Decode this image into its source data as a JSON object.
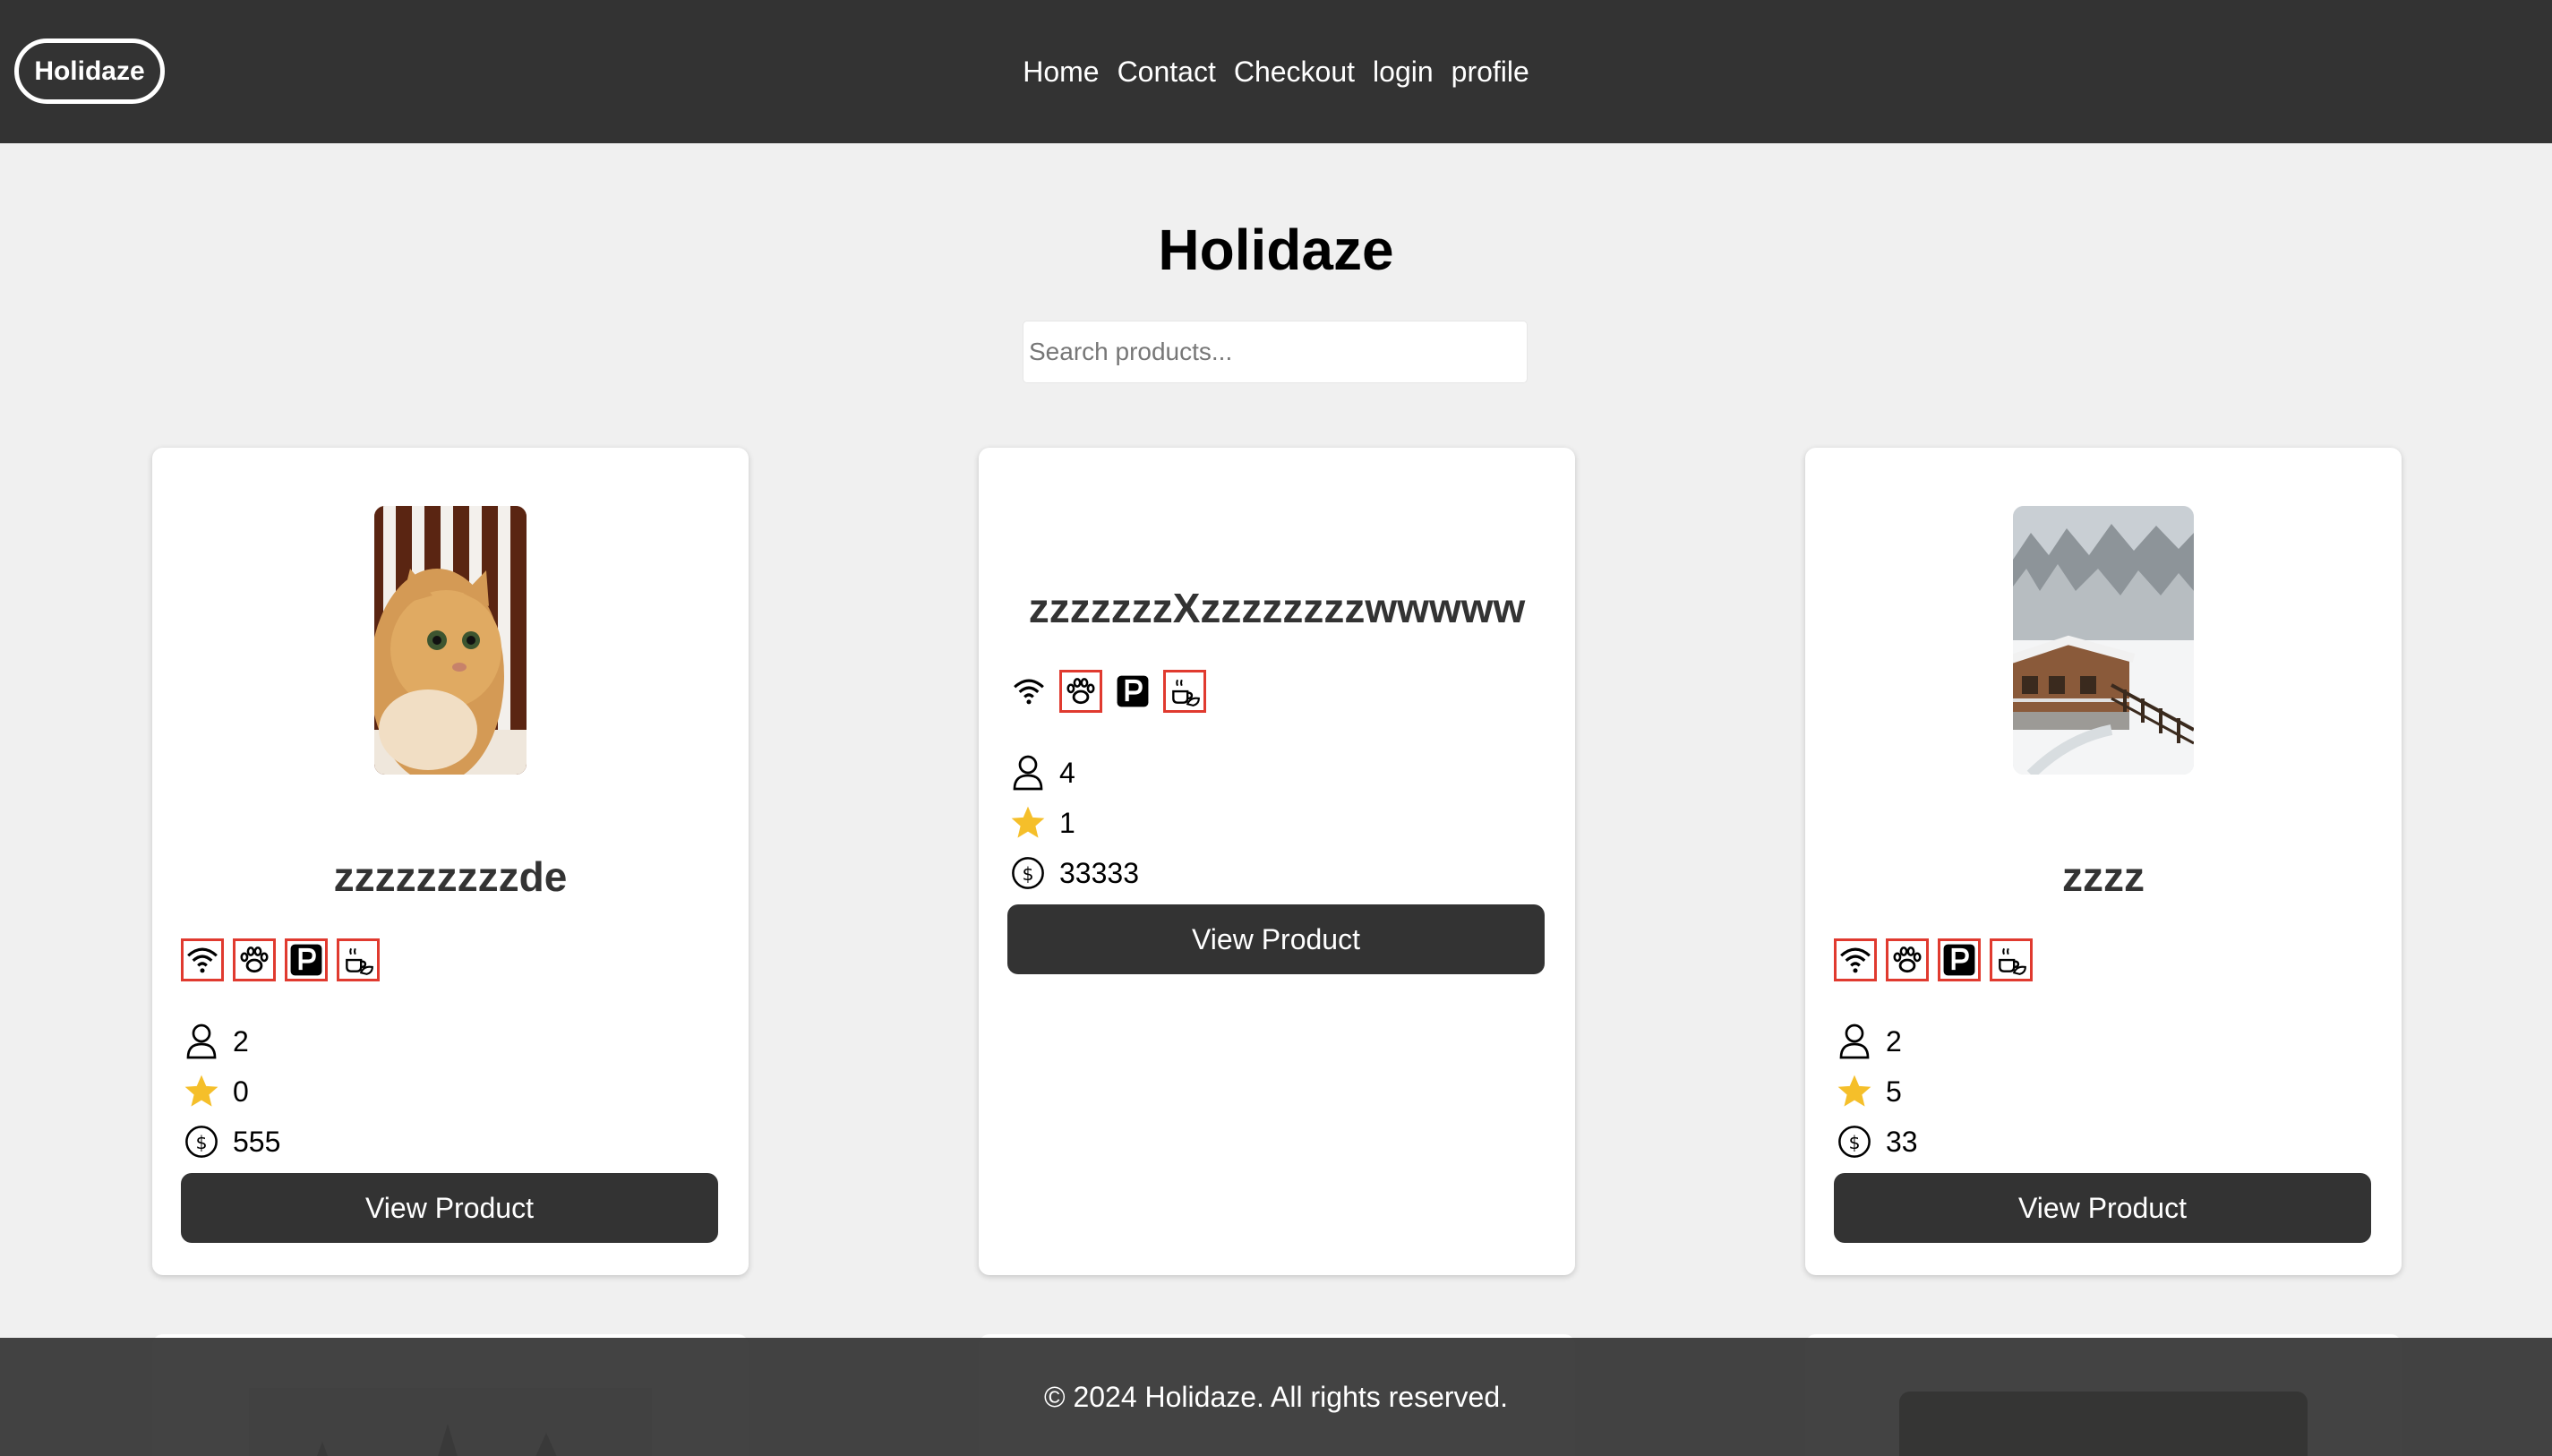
{
  "nav": {
    "logo": "Holidaze",
    "links": [
      "Home",
      "Contact",
      "Checkout",
      "login",
      "profile"
    ]
  },
  "page": {
    "title": "Holidaze",
    "search_placeholder": "Search products..."
  },
  "products": [
    {
      "name": "zzzzzzzzzde",
      "image": "orange-cat-photo",
      "amenities": [
        "wifi-icon",
        "pets-icon",
        "parking-icon",
        "breakfast-icon"
      ],
      "guests": "2",
      "rating": "0",
      "price": "555",
      "button": "View Product"
    },
    {
      "name": "zzzzzzzXzzzzzzzzwwwww",
      "image": null,
      "amenities": [
        "wifi-icon",
        "pets-icon",
        "parking-icon",
        "breakfast-icon"
      ],
      "guests": "4",
      "rating": "1",
      "price": "33333",
      "button": "View Product"
    },
    {
      "name": "zzzz",
      "image": "snowy-cabin-photo",
      "amenities": [
        "wifi-icon",
        "pets-icon",
        "parking-icon",
        "breakfast-icon"
      ],
      "guests": "2",
      "rating": "5",
      "price": "33",
      "button": "View Product"
    }
  ],
  "footer": {
    "copyright": "© 2024 Holidaze. All rights reserved."
  },
  "colors": {
    "header_bg": "#333333",
    "page_bg": "#f0f0f0",
    "amenity_border": "#e03a2f",
    "star": "#f5bf2a",
    "button_bg": "#333333"
  }
}
